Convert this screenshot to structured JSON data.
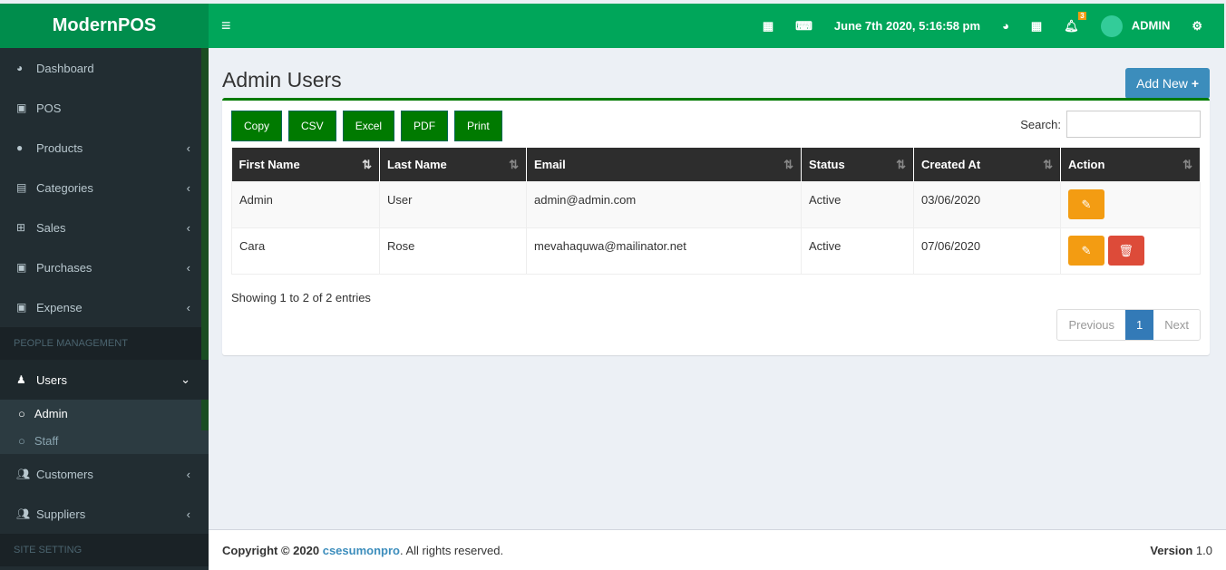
{
  "app": {
    "title": "ModernPOS"
  },
  "topbar": {
    "datetime": "June 7th 2020, 5:16:58 pm",
    "notif_count": "3",
    "user": "ADMIN"
  },
  "sidebar": {
    "items": [
      {
        "label": "Dashboard",
        "icon": "◕"
      },
      {
        "label": "POS",
        "icon": "▣"
      },
      {
        "label": "Products",
        "icon": "●"
      },
      {
        "label": "Categories",
        "icon": "▤"
      },
      {
        "label": "Sales",
        "icon": "⊞"
      },
      {
        "label": "Purchases",
        "icon": "▣"
      },
      {
        "label": "Expense",
        "icon": "▣"
      }
    ],
    "header1": "PEOPLE MANAGEMENT",
    "users": "Users",
    "sub": [
      "Admin",
      "Staff"
    ],
    "customers": "Customers",
    "suppliers": "Suppliers",
    "header2": "SITE SETTING"
  },
  "page": {
    "title": "Admin Users",
    "add_new": "Add New",
    "buttons": [
      "Copy",
      "CSV",
      "Excel",
      "PDF",
      "Print"
    ],
    "search_label": "Search:",
    "search_value": "",
    "columns": [
      "First Name",
      "Last Name",
      "Email",
      "Status",
      "Created At",
      "Action"
    ],
    "rows": [
      [
        "Admin",
        "User",
        "admin@admin.com",
        "Active",
        "03/06/2020"
      ],
      [
        "Cara",
        "Rose",
        "mevahaquwa@mailinator.net",
        "Active",
        "07/06/2020"
      ]
    ],
    "info": "Showing 1 to 2 of 2 entries",
    "prev": "Previous",
    "page": "1",
    "next": "Next"
  },
  "footer": {
    "copy": "Copyright © 2020 ",
    "link": "csesumonpro",
    "rest": ". All rights reserved.",
    "version_label": "Version",
    "version": "1.0"
  }
}
